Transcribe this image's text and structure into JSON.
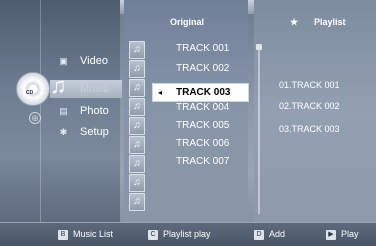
{
  "header": {
    "original_label": "Original",
    "playlist_label": "Playlist",
    "star": "★"
  },
  "menu": {
    "disc_label": "CD",
    "items": [
      {
        "label": "Video",
        "icon": "video-icon"
      },
      {
        "label": "Music",
        "icon": "music-icon",
        "selected": true
      },
      {
        "label": "Photo",
        "icon": "photo-icon"
      },
      {
        "label": "Setup",
        "icon": "setup-icon"
      }
    ]
  },
  "tracks": {
    "items": [
      "TRACK 001",
      "TRACK 002",
      "TRACK 003",
      "TRACK 004",
      "TRACK 005",
      "TRACK 006",
      "TRACK 007"
    ],
    "selected": "TRACK 003",
    "selected_arrow": "◂"
  },
  "playlist": {
    "items": [
      "01.TRACK 001",
      "02.TRACK 002",
      "03.TRACK 003"
    ]
  },
  "footer": {
    "music_list_key": "B",
    "music_list": "Music List",
    "playlist_play_key": "C",
    "playlist_play": "Playlist play",
    "add_key": "D",
    "add": "Add",
    "play_key": "▶",
    "play": "Play"
  },
  "colors": {
    "accent": "#8a97a8",
    "footer": "#485466",
    "selected_row": "#ffffff"
  }
}
